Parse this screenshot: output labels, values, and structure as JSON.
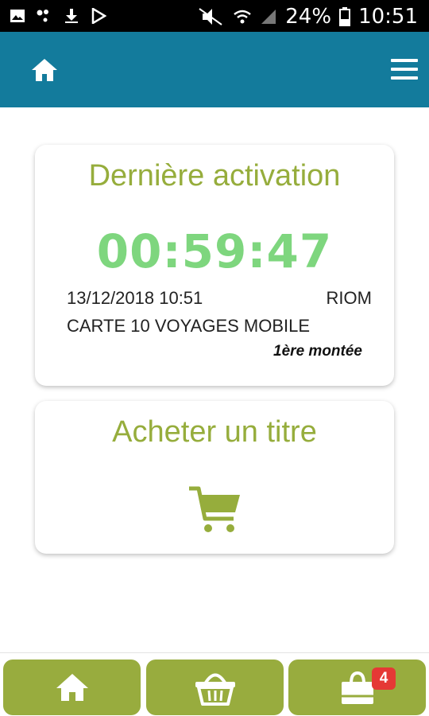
{
  "status_bar": {
    "battery": "24%",
    "time": "10:51"
  },
  "header": {
    "home_icon": "home-icon",
    "menu_icon": "hamburger-menu-icon"
  },
  "activation_card": {
    "title": "Dernière activation",
    "timer": "00:59:47",
    "date": "13/12/2018 10:51",
    "city": "RIOM",
    "product": "CARTE 10 VOYAGES MOBILE",
    "stage": "1ère montée"
  },
  "purchase_card": {
    "title": "Acheter un titre",
    "icon": "shopping-cart-icon"
  },
  "bottom_nav": {
    "items": [
      {
        "icon": "home-icon"
      },
      {
        "icon": "basket-icon"
      },
      {
        "icon": "shopping-bag-icon",
        "badge": "4"
      }
    ]
  },
  "colors": {
    "header": "#137b9c",
    "accent_green": "#96ad3c",
    "timer_green": "#7ed67e",
    "badge_red": "#e53935"
  }
}
